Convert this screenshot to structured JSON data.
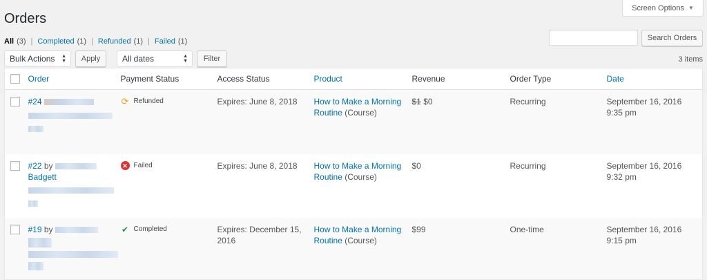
{
  "header": {
    "title": "Orders",
    "screen_options": "Screen Options"
  },
  "filters": {
    "all": "All",
    "all_count": "(3)",
    "completed": "Completed",
    "completed_count": "(1)",
    "refunded": "Refunded",
    "refunded_count": "(1)",
    "failed": "Failed",
    "failed_count": "(1)",
    "separator": "|"
  },
  "search": {
    "value": "",
    "button": "Search Orders"
  },
  "toolbar": {
    "bulk_actions": "Bulk Actions",
    "apply": "Apply",
    "dates": "All dates",
    "filter": "Filter",
    "items_count": "3 items"
  },
  "table": {
    "columns": [
      "Order",
      "Payment Status",
      "Access Status",
      "Product",
      "Revenue",
      "Order Type",
      "Date"
    ],
    "rows": [
      {
        "order_id": "#24",
        "by": "",
        "customer": "",
        "payment_status": "Refunded",
        "payment_icon": "refunded-icon",
        "access_status": "Expires: June 8, 2018",
        "product_link": "How to Make a Morning Routine",
        "product_link_1": "How to Make a Morning",
        "product_link_2": "Routine",
        "product_type": "(Course)",
        "revenue_old": "$1",
        "revenue": "$0",
        "order_type": "Recurring",
        "date": "September 16, 2016",
        "time": "9:35 pm"
      },
      {
        "order_id": "#22",
        "by": "by",
        "customer": "Badgett",
        "payment_status": "Failed",
        "payment_icon": "failed-icon",
        "access_status": "Expires: June 8, 2018",
        "product_link_1": "How to Make a Morning",
        "product_link_2": "Routine",
        "product_type": "(Course)",
        "revenue": "$0",
        "order_type": "Recurring",
        "date": "September 16, 2016",
        "time": "9:32 pm"
      },
      {
        "order_id": "#19",
        "by": "by",
        "customer": "",
        "payment_status": "Completed",
        "payment_icon": "completed-icon",
        "access_status_1": "Expires: December 15,",
        "access_status_2": "2016",
        "product_link_1": "How to Make a Morning",
        "product_link_2": "Routine",
        "product_type": "(Course)",
        "revenue": "$99",
        "order_type": "One-time",
        "date": "September 16, 2016",
        "time": "9:15 pm"
      }
    ]
  },
  "colors": {
    "link": "#0073aa",
    "failed": "#dc3232",
    "completed": "#2e8b57",
    "refunded": "#f0a020"
  }
}
